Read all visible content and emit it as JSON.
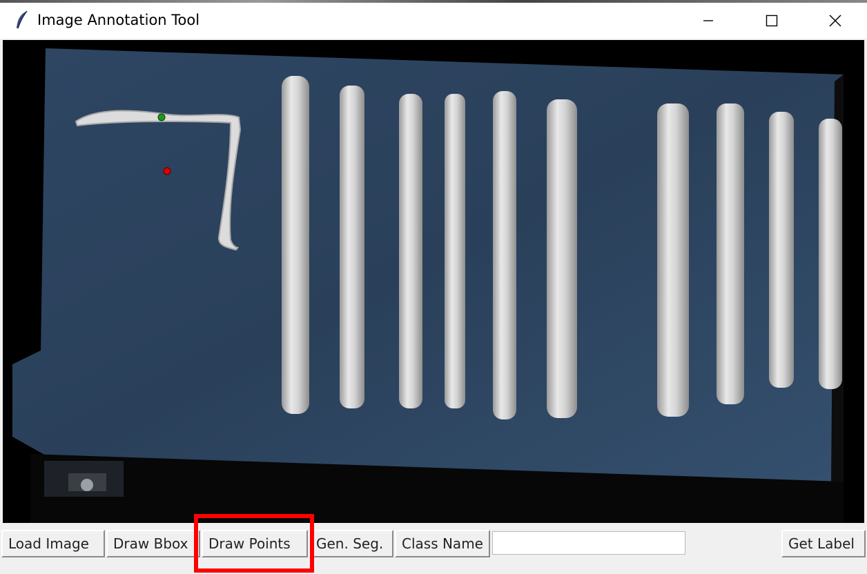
{
  "window": {
    "title": "Image Annotation Tool",
    "icon": "feather-icon",
    "controls": {
      "minimize": "minimize-icon",
      "maximize": "maximize-icon",
      "close": "close-icon"
    }
  },
  "canvas": {
    "points": [
      {
        "label": "positive",
        "color": "#1a9c1a"
      },
      {
        "label": "negative",
        "color": "#e00000"
      }
    ]
  },
  "toolbar": {
    "load_image": "Load Image",
    "draw_bbox": "Draw Bbox",
    "draw_points": "Draw Points",
    "gen_seg": "Gen. Seg.",
    "class_name_label": "Class Name",
    "class_name_value": "",
    "get_label": "Get Label"
  },
  "highlight": {
    "target": "draw_points",
    "color": "#ff0000"
  }
}
